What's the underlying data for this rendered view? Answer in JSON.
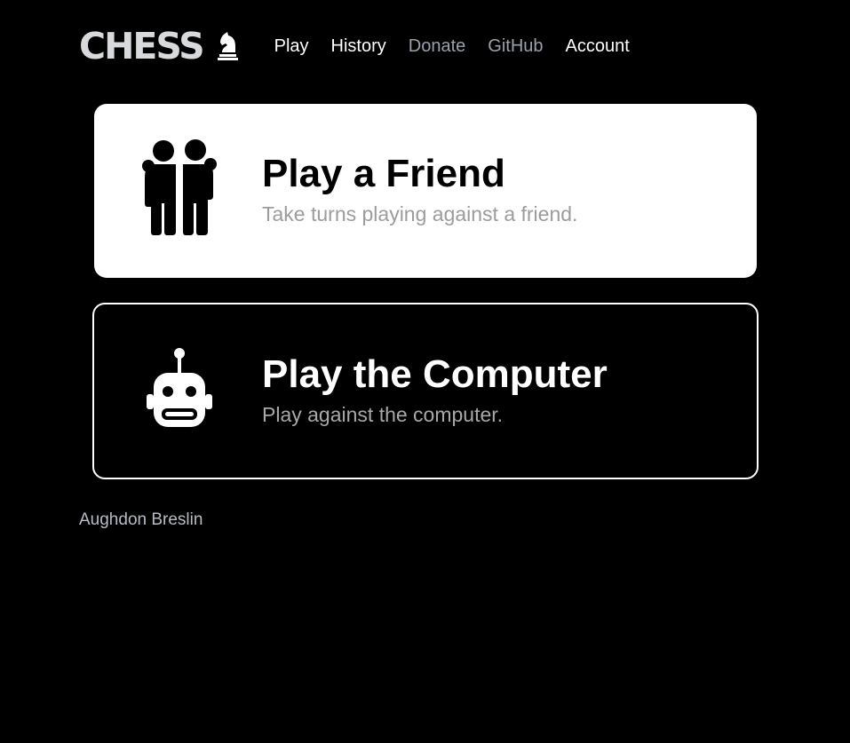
{
  "header": {
    "logo_text": "CHESS",
    "nav": [
      {
        "label": "Play"
      },
      {
        "label": "History"
      },
      {
        "label": "Donate"
      },
      {
        "label": "GitHub"
      },
      {
        "label": "Account"
      }
    ]
  },
  "cards": [
    {
      "icon": "two-people-icon",
      "title": "Play a Friend",
      "description": "Take turns playing against a friend."
    },
    {
      "icon": "robot-icon",
      "title": "Play the Computer",
      "description": "Play against the computer."
    }
  ],
  "footer": {
    "author": "Aughdon Breslin"
  },
  "colors": {
    "background": "#000000",
    "logo": "#d8d9dd",
    "nav_active": "#ffffff",
    "nav_dim": "#9aa1ab",
    "card_light": "#ffffff",
    "card_dark": "#000000",
    "muted_text": "#9c9c9c"
  }
}
